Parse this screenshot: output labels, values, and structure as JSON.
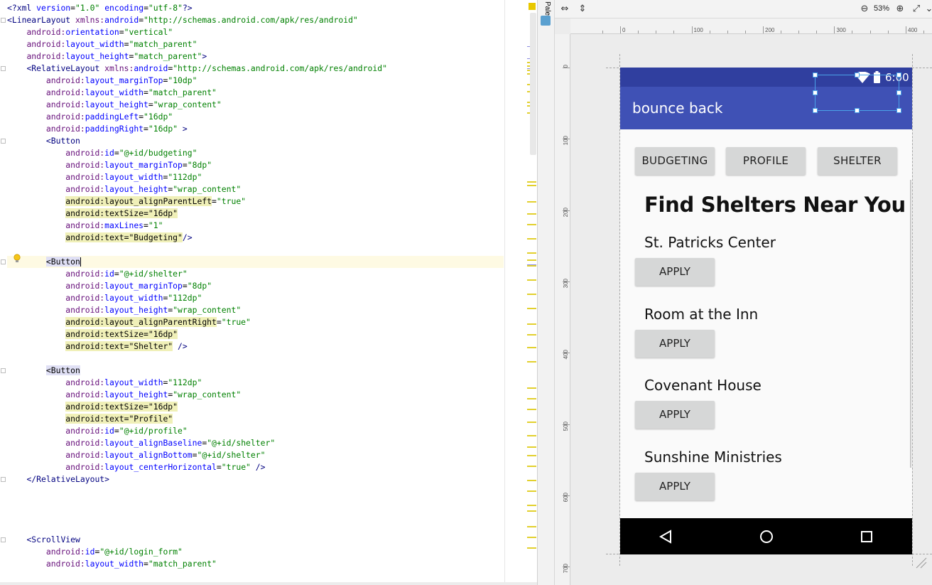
{
  "editor": {
    "lines": [
      [
        [
          "tag",
          "<?xml "
        ],
        [
          "attr",
          "version"
        ],
        [
          "t",
          "="
        ],
        [
          "val",
          "\"1.0\""
        ],
        [
          "t",
          " "
        ],
        [
          "attr",
          "encoding"
        ],
        [
          "t",
          "="
        ],
        [
          "val",
          "\"utf-8\""
        ],
        [
          "tag",
          "?>"
        ]
      ],
      [
        [
          "tag",
          "<LinearLayout "
        ],
        [
          "ns",
          "xmlns:"
        ],
        [
          "attr",
          "android"
        ],
        [
          "t",
          "="
        ],
        [
          "val",
          "\"http://schemas.android.com/apk/res/android\""
        ]
      ],
      [
        [
          "t",
          "    "
        ],
        [
          "ns",
          "android:"
        ],
        [
          "attr",
          "orientation"
        ],
        [
          "t",
          "="
        ],
        [
          "val",
          "\"vertical\""
        ]
      ],
      [
        [
          "t",
          "    "
        ],
        [
          "ns",
          "android:"
        ],
        [
          "attr",
          "layout_width"
        ],
        [
          "t",
          "="
        ],
        [
          "val",
          "\"match_parent\""
        ]
      ],
      [
        [
          "t",
          "    "
        ],
        [
          "ns",
          "android:"
        ],
        [
          "attr",
          "layout_height"
        ],
        [
          "t",
          "="
        ],
        [
          "val",
          "\"match_parent\""
        ],
        [
          "tag",
          ">"
        ]
      ],
      [
        [
          "t",
          "    "
        ],
        [
          "tag",
          "<RelativeLayout "
        ],
        [
          "ns",
          "xmlns:"
        ],
        [
          "attr",
          "android"
        ],
        [
          "t",
          "="
        ],
        [
          "val",
          "\"http://schemas.android.com/apk/res/android\""
        ]
      ],
      [
        [
          "t",
          "        "
        ],
        [
          "ns",
          "android:"
        ],
        [
          "attr",
          "layout_marginTop"
        ],
        [
          "t",
          "="
        ],
        [
          "val",
          "\"10dp\""
        ]
      ],
      [
        [
          "t",
          "        "
        ],
        [
          "ns",
          "android:"
        ],
        [
          "attr",
          "layout_width"
        ],
        [
          "t",
          "="
        ],
        [
          "val",
          "\"match_parent\""
        ]
      ],
      [
        [
          "t",
          "        "
        ],
        [
          "ns",
          "android:"
        ],
        [
          "attr",
          "layout_height"
        ],
        [
          "t",
          "="
        ],
        [
          "val",
          "\"wrap_content\""
        ]
      ],
      [
        [
          "t",
          "        "
        ],
        [
          "ns",
          "android:"
        ],
        [
          "attr",
          "paddingLeft"
        ],
        [
          "t",
          "="
        ],
        [
          "val",
          "\"16dp\""
        ]
      ],
      [
        [
          "t",
          "        "
        ],
        [
          "ns",
          "android:"
        ],
        [
          "attr",
          "paddingRight"
        ],
        [
          "t",
          "="
        ],
        [
          "val",
          "\"16dp\""
        ],
        [
          "tag",
          " >"
        ]
      ],
      [
        [
          "t",
          "        "
        ],
        [
          "tag",
          "<Button"
        ]
      ],
      [
        [
          "t",
          "            "
        ],
        [
          "ns",
          "android:"
        ],
        [
          "attr",
          "id"
        ],
        [
          "t",
          "="
        ],
        [
          "val",
          "\"@+id/budgeting\""
        ]
      ],
      [
        [
          "t",
          "            "
        ],
        [
          "ns",
          "android:"
        ],
        [
          "attr",
          "layout_marginTop"
        ],
        [
          "t",
          "="
        ],
        [
          "val",
          "\"8dp\""
        ]
      ],
      [
        [
          "t",
          "            "
        ],
        [
          "ns",
          "android:"
        ],
        [
          "attr",
          "layout_width"
        ],
        [
          "t",
          "="
        ],
        [
          "val",
          "\"112dp\""
        ]
      ],
      [
        [
          "t",
          "            "
        ],
        [
          "ns",
          "android:"
        ],
        [
          "attr",
          "layout_height"
        ],
        [
          "t",
          "="
        ],
        [
          "val",
          "\"wrap_content\""
        ]
      ],
      [
        [
          "t",
          "            "
        ],
        [
          "hl",
          "android:layout_alignParentLeft"
        ],
        [
          "t",
          "="
        ],
        [
          "val",
          "\"true\""
        ]
      ],
      [
        [
          "t",
          "            "
        ],
        [
          "hl",
          "android:textSize=\"16dp\""
        ]
      ],
      [
        [
          "t",
          "            "
        ],
        [
          "ns",
          "android:"
        ],
        [
          "attr",
          "maxLines"
        ],
        [
          "t",
          "="
        ],
        [
          "val",
          "\"1\""
        ]
      ],
      [
        [
          "t",
          "            "
        ],
        [
          "hl",
          "android:text=\"Budgeting\""
        ],
        [
          "tag",
          "/>"
        ]
      ],
      [],
      [
        [
          "t",
          "        "
        ],
        [
          "hltag",
          "<Button"
        ],
        [
          "caret",
          ""
        ]
      ],
      [
        [
          "t",
          "            "
        ],
        [
          "ns",
          "android:"
        ],
        [
          "attr",
          "id"
        ],
        [
          "t",
          "="
        ],
        [
          "val",
          "\"@+id/shelter\""
        ]
      ],
      [
        [
          "t",
          "            "
        ],
        [
          "ns",
          "android:"
        ],
        [
          "attr",
          "layout_marginTop"
        ],
        [
          "t",
          "="
        ],
        [
          "val",
          "\"8dp\""
        ]
      ],
      [
        [
          "t",
          "            "
        ],
        [
          "ns",
          "android:"
        ],
        [
          "attr",
          "layout_width"
        ],
        [
          "t",
          "="
        ],
        [
          "val",
          "\"112dp\""
        ]
      ],
      [
        [
          "t",
          "            "
        ],
        [
          "ns",
          "android:"
        ],
        [
          "attr",
          "layout_height"
        ],
        [
          "t",
          "="
        ],
        [
          "val",
          "\"wrap_content\""
        ]
      ],
      [
        [
          "t",
          "            "
        ],
        [
          "hl",
          "android:layout_alignParentRight"
        ],
        [
          "t",
          "="
        ],
        [
          "val",
          "\"true\""
        ]
      ],
      [
        [
          "t",
          "            "
        ],
        [
          "hl",
          "android:textSize=\"16dp\""
        ]
      ],
      [
        [
          "t",
          "            "
        ],
        [
          "hl",
          "android:text=\"Shelter\""
        ],
        [
          "tag",
          " />"
        ]
      ],
      [],
      [
        [
          "t",
          "        "
        ],
        [
          "hltag",
          "<Button"
        ]
      ],
      [
        [
          "t",
          "            "
        ],
        [
          "ns",
          "android:"
        ],
        [
          "attr",
          "layout_width"
        ],
        [
          "t",
          "="
        ],
        [
          "val",
          "\"112dp\""
        ]
      ],
      [
        [
          "t",
          "            "
        ],
        [
          "ns",
          "android:"
        ],
        [
          "attr",
          "layout_height"
        ],
        [
          "t",
          "="
        ],
        [
          "val",
          "\"wrap_content\""
        ]
      ],
      [
        [
          "t",
          "            "
        ],
        [
          "hl",
          "android:textSize=\"16dp\""
        ]
      ],
      [
        [
          "t",
          "            "
        ],
        [
          "hl",
          "android:text=\"Profile\""
        ]
      ],
      [
        [
          "t",
          "            "
        ],
        [
          "ns",
          "android:"
        ],
        [
          "attr",
          "id"
        ],
        [
          "t",
          "="
        ],
        [
          "val",
          "\"@+id/profile\""
        ]
      ],
      [
        [
          "t",
          "            "
        ],
        [
          "ns",
          "android:"
        ],
        [
          "attr",
          "layout_alignBaseline"
        ],
        [
          "t",
          "="
        ],
        [
          "val",
          "\"@+id/shelter\""
        ]
      ],
      [
        [
          "t",
          "            "
        ],
        [
          "ns",
          "android:"
        ],
        [
          "attr",
          "layout_alignBottom"
        ],
        [
          "t",
          "="
        ],
        [
          "val",
          "\"@+id/shelter\""
        ]
      ],
      [
        [
          "t",
          "            "
        ],
        [
          "ns",
          "android:"
        ],
        [
          "attr",
          "layout_centerHorizontal"
        ],
        [
          "t",
          "="
        ],
        [
          "val",
          "\"true\""
        ],
        [
          "tag",
          " />"
        ]
      ],
      [
        [
          "t",
          "    "
        ],
        [
          "tag",
          "</RelativeLayout>"
        ]
      ],
      [],
      [],
      [],
      [],
      [
        [
          "t",
          "    "
        ],
        [
          "tag",
          "<ScrollView"
        ]
      ],
      [
        [
          "t",
          "        "
        ],
        [
          "ns",
          "android:"
        ],
        [
          "attr",
          "id"
        ],
        [
          "t",
          "="
        ],
        [
          "val",
          "\"@+id/login_form\""
        ]
      ],
      [
        [
          "t",
          "        "
        ],
        [
          "ns",
          "android:"
        ],
        [
          "attr",
          "layout_width"
        ],
        [
          "t",
          "="
        ],
        [
          "val",
          "\"match_parent\""
        ]
      ]
    ],
    "current_line": 21
  },
  "palette": {
    "tab_label": "Palette"
  },
  "design": {
    "zoom": "53%",
    "ruler_top_labels": [
      "0",
      "100",
      "200",
      "300",
      "400"
    ],
    "ruler_left_labels": [
      "0",
      "100",
      "200",
      "300",
      "400",
      "500",
      "600",
      "700"
    ]
  },
  "phone": {
    "status_time": "6:00",
    "app_title": "bounce back",
    "nav_buttons": [
      "BUDGETING",
      "PROFILE",
      "SHELTER"
    ],
    "heading": "Find Shelters Near You",
    "shelters": [
      {
        "name": "St. Patricks Center",
        "apply": "APPLY"
      },
      {
        "name": "Room at the Inn",
        "apply": "APPLY"
      },
      {
        "name": "Covenant House",
        "apply": "APPLY"
      },
      {
        "name": "Sunshine Ministries",
        "apply": "APPLY"
      }
    ]
  },
  "colors": {
    "status_bar": "#303f9f",
    "app_bar": "#3f51b5",
    "button_bg": "#d6d7d7",
    "selection": "#4aa3e8"
  }
}
